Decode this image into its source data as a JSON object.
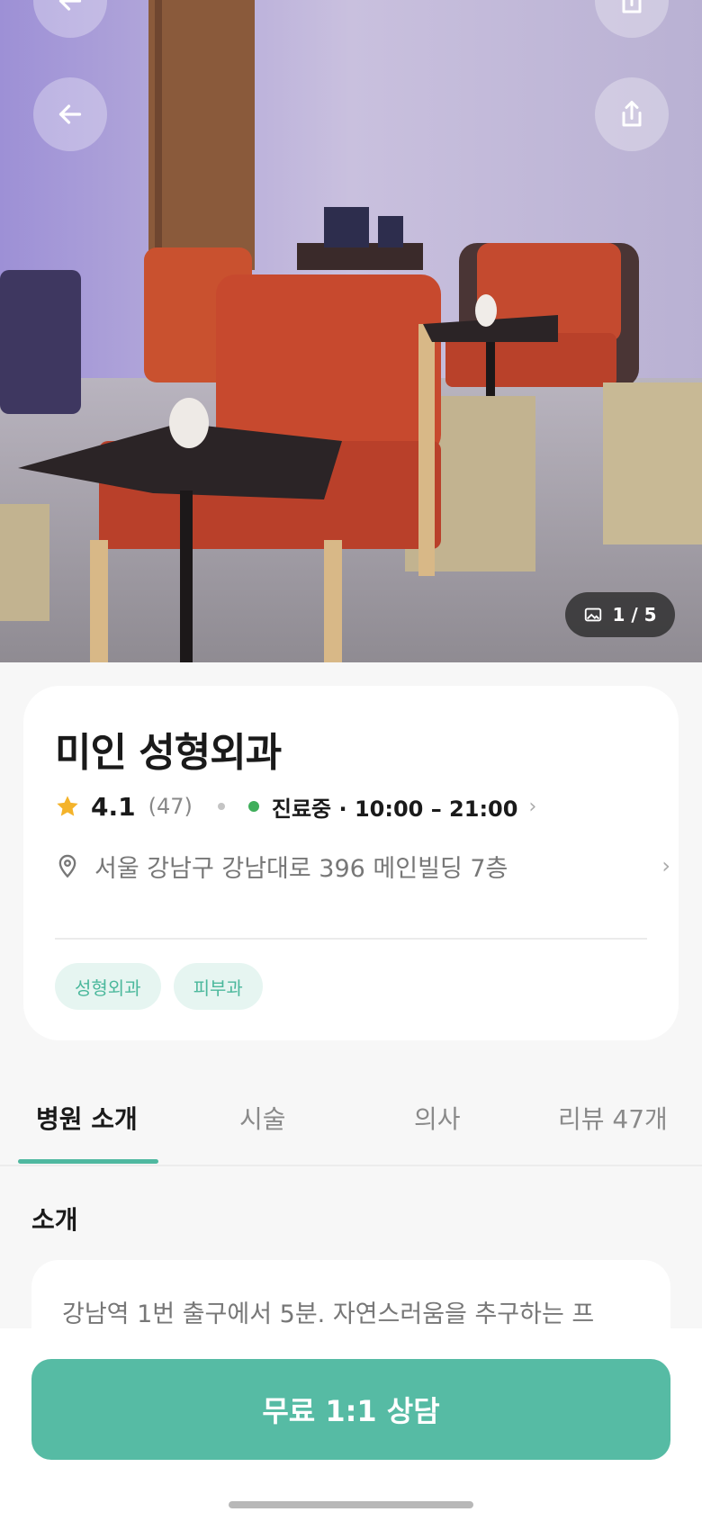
{
  "hero": {
    "image_counter": "1 / 5"
  },
  "clinic": {
    "name": "미인 성형외과",
    "rating": "4.1",
    "review_count": "(47)",
    "status_hours": "진료중 · 10:00 – 21:00",
    "address": "서울 강남구 강남대로 396 메인빌딩 7층",
    "tags": [
      "성형외과",
      "피부과"
    ]
  },
  "tabs": {
    "intro": "병원 소개",
    "procedures": "시술",
    "doctors": "의사",
    "reviews": "리뷰 47개"
  },
  "intro": {
    "title": "소개",
    "text": "강남역 1번 출구에서 5분. 자연스러움을 추구하는 프"
  },
  "cta": {
    "label": "무료 1:1 상담"
  },
  "colors": {
    "accent": "#56bba4",
    "chip_bg": "#e6f5f1",
    "chip_text": "#4bb89c",
    "open_status": "#3fae5b",
    "star": "#f4b32a"
  }
}
